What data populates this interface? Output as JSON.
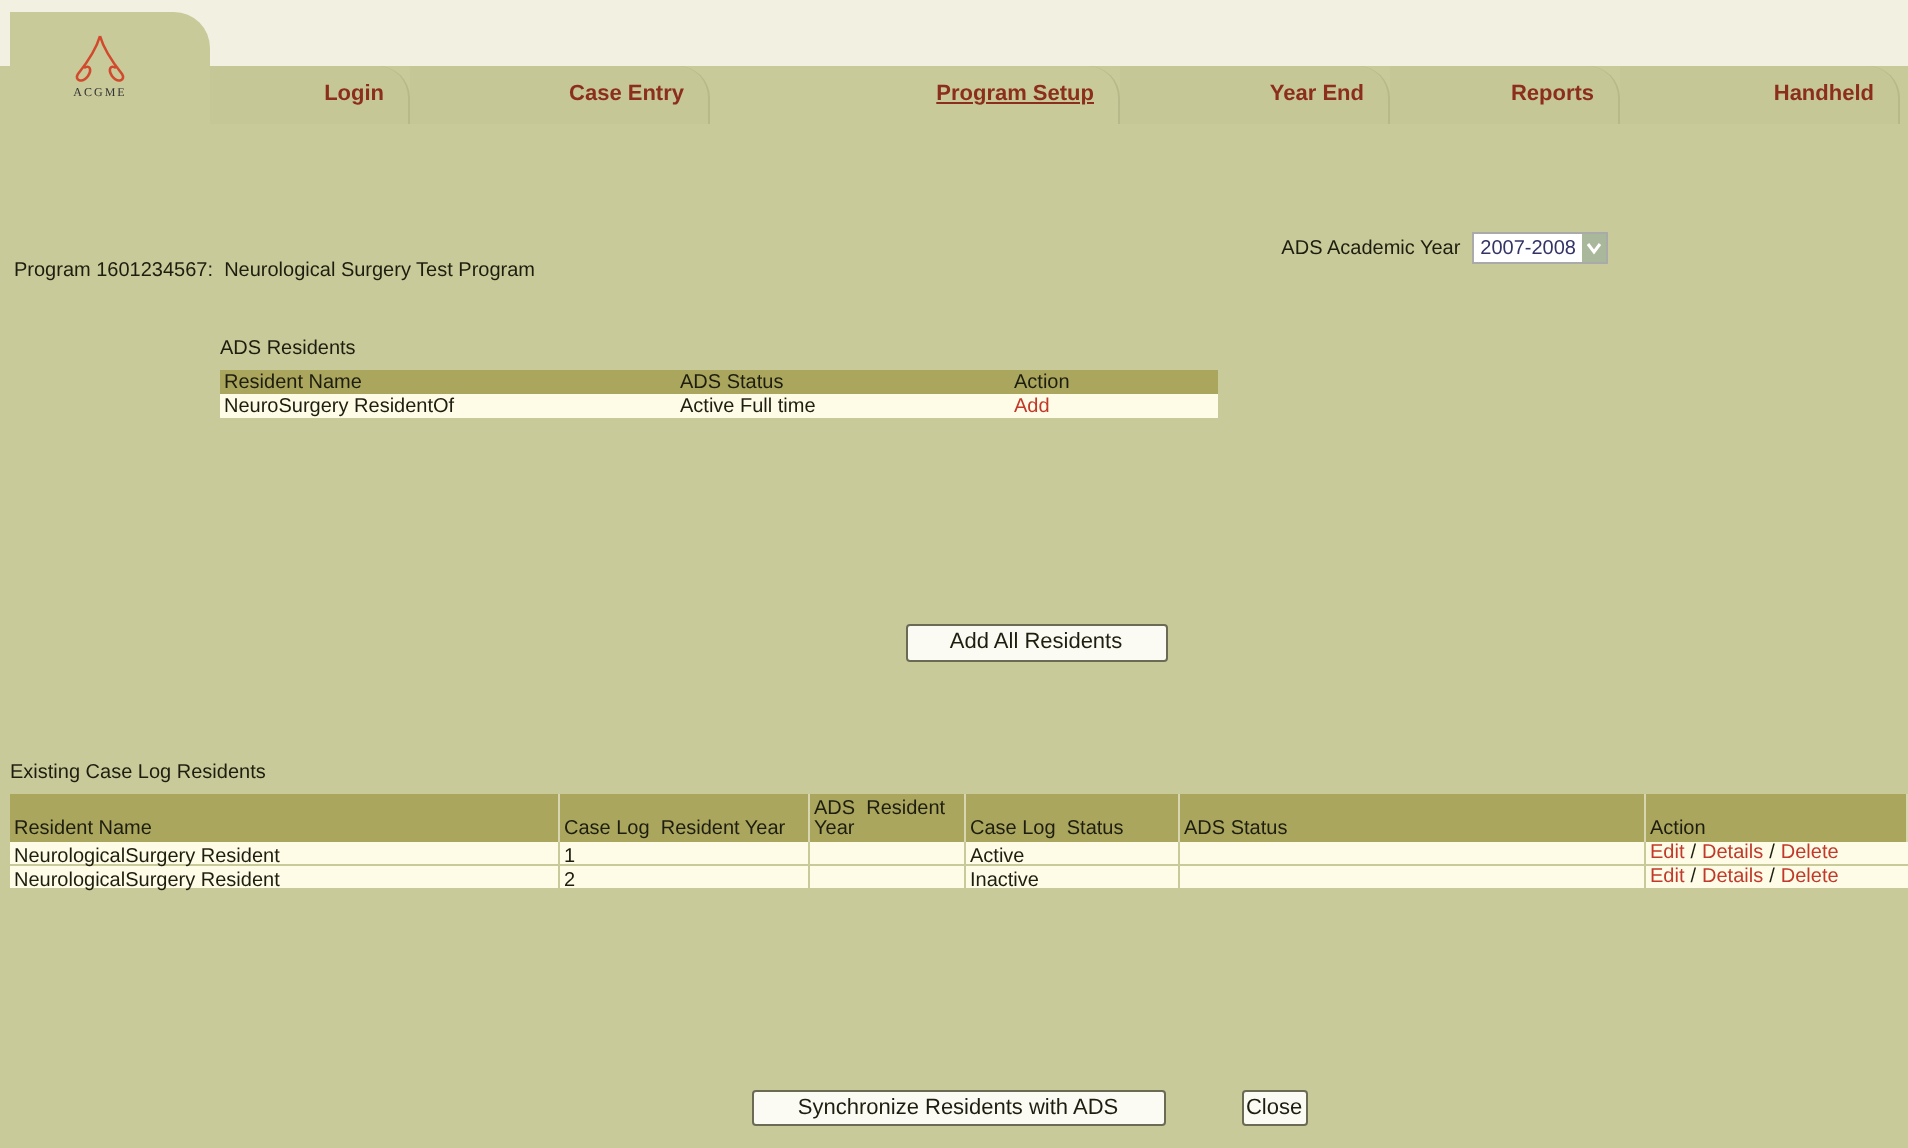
{
  "logo": {
    "text": "ACGME"
  },
  "tabs": [
    {
      "label": "Login",
      "selected": false
    },
    {
      "label": "Case Entry",
      "selected": false
    },
    {
      "label": "Program Setup",
      "selected": true
    },
    {
      "label": "Year End",
      "selected": false
    },
    {
      "label": "Reports",
      "selected": false
    },
    {
      "label": "Handheld",
      "selected": false
    }
  ],
  "program": {
    "label": "Program 1601234567:  Neurological Surgery Test Program"
  },
  "academic_year": {
    "label": "ADS Academic Year",
    "value": "2007-2008"
  },
  "ads_residents": {
    "title": "ADS Residents",
    "columns": [
      "Resident Name",
      "ADS Status",
      "Action"
    ],
    "rows": [
      {
        "name": "NeuroSurgery ResidentOf",
        "status": "Active Full time",
        "action": "Add"
      }
    ]
  },
  "add_all_button": "Add All Residents",
  "existing": {
    "title": "Existing Case Log Residents",
    "columns": [
      "Resident Name",
      "Case Log  Resident Year",
      "ADS  Resident Year",
      "Case Log  Status",
      "ADS Status",
      "Action"
    ],
    "rows": [
      {
        "name": "NeurologicalSurgery Resident",
        "year": "1",
        "status": "Active",
        "actions": [
          "Edit",
          "Details",
          "Delete"
        ],
        "separator": "/"
      },
      {
        "name": "NeurologicalSurgery Resident",
        "year": "2",
        "status": "Inactive",
        "actions": [
          "Edit",
          "Details",
          "Delete"
        ],
        "separator": "/"
      }
    ]
  },
  "footer_buttons": [
    "Synchronize Residents with ADS",
    "Close"
  ]
}
